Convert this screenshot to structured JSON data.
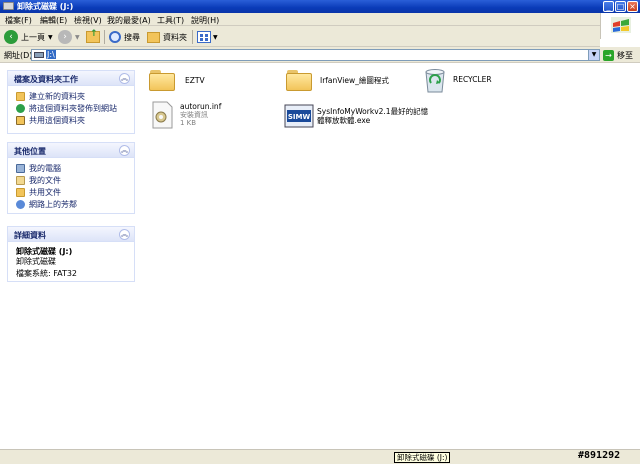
{
  "window": {
    "title": "卸除式磁碟 (J:)"
  },
  "menubar": {
    "items": [
      "檔案(F)",
      "編輯(E)",
      "檢視(V)",
      "我的最愛(A)",
      "工具(T)",
      "說明(H)"
    ]
  },
  "toolbar": {
    "back_label": "上一頁",
    "search_label": "搜尋",
    "folders_label": "資料夾"
  },
  "address": {
    "label": "網址(D)",
    "value": "J:\\",
    "go_label": "移至"
  },
  "tasks_panel": {
    "title": "檔案及資料夾工作",
    "items": [
      {
        "label": "建立新的資料夾",
        "icon": "new-folder-icon"
      },
      {
        "label": "將這個資料夾發佈到網站",
        "icon": "publish-web-icon"
      },
      {
        "label": "共用這個資料夾",
        "icon": "share-folder-icon"
      }
    ]
  },
  "places_panel": {
    "title": "其他位置",
    "items": [
      {
        "label": "我的電腦",
        "icon": "my-computer-icon"
      },
      {
        "label": "我的文件",
        "icon": "my-documents-icon"
      },
      {
        "label": "共用文件",
        "icon": "shared-documents-icon"
      },
      {
        "label": "網路上的芳鄰",
        "icon": "network-places-icon"
      }
    ]
  },
  "details_panel": {
    "title": "詳細資料",
    "name": "卸除式磁碟 (J:)",
    "type": "卸除式磁碟",
    "filesystem": "檔案系統: FAT32"
  },
  "files": [
    {
      "name": "EZTV",
      "icon": "folder-icon"
    },
    {
      "name": "IrfanView_繪圖程式",
      "icon": "folder-icon"
    },
    {
      "name": "RECYCLER",
      "icon": "recycle-bin-icon"
    },
    {
      "name": "autorun.inf",
      "type": "安裝資訊",
      "size": "1 KB",
      "icon": "setup-info-icon"
    },
    {
      "name_line1": "SysInfoMyWorkv2.1最好的記憶",
      "name_line2": "體釋放軟體.exe",
      "icon": "app-exe-icon"
    }
  ],
  "status": {
    "tooltip": "卸除式磁碟 (J:)",
    "watermark": "#891292"
  },
  "colors": {
    "titlebar": "#0a3bb8",
    "chrome": "#ece9d8",
    "selection": "#316ac5",
    "task_link": "#1a2a6c"
  }
}
